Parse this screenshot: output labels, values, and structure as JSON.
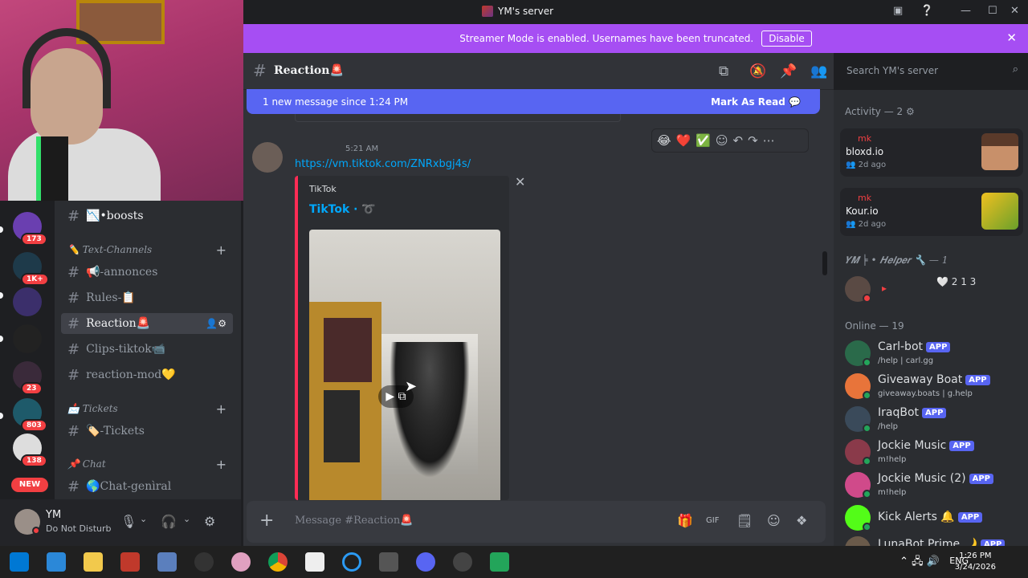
{
  "window": {
    "title": "YM's server"
  },
  "banner": {
    "text": "Streamer Mode is enabled. Usernames have been truncated.",
    "button": "Disable"
  },
  "servers": [
    {
      "badge": "173",
      "color": "#6a3fb0"
    },
    {
      "badge": "1K+",
      "color": "#1e3a4a"
    },
    {
      "badge": "",
      "color": "#3b2f6b"
    },
    {
      "badge": "",
      "color": "#222222"
    },
    {
      "badge": "23",
      "color": "#3a2a3a"
    },
    {
      "badge": "803",
      "color": "#1e5a6a"
    },
    {
      "badge": "138",
      "color": "#dddddd"
    }
  ],
  "new_badge": "NEW",
  "channels": {
    "top": "📉•boosts",
    "cat1": "✏️ Text-Channels",
    "c1": "📢-annonces",
    "c2": "Rules-📋",
    "c3": "Reaction🚨",
    "c4": "Clips-tiktok📹",
    "c5": "reaction-mod💛",
    "cat2": "📩 Tickets",
    "c6": "🏷️-Tickets",
    "cat3": "📌 Chat",
    "c7": "🌎Chat-genìral"
  },
  "user": {
    "name": "YM",
    "status": "Do Not Disturb"
  },
  "header": {
    "channel": "Reaction🚨",
    "search": "Search YM's server"
  },
  "new_messages": {
    "text": "1 new message since 1:24 PM",
    "action": "Mark As Read"
  },
  "message": {
    "time": "5:21 AM",
    "link": "https://vm.tiktok.com/ZNRxbgj4s/",
    "embed_provider": "TikTok",
    "embed_author": "TikTok · ➰"
  },
  "reactions": [
    "😂",
    "❤️",
    "✅"
  ],
  "composer": {
    "placeholder": "Message #Reaction🚨"
  },
  "members": {
    "activity_header": "Activity — 2",
    "activity": [
      {
        "user": "mk",
        "game": "bloxd.io",
        "time": "2d ago"
      },
      {
        "user": "mk",
        "game": "Kour.io",
        "time": "2d ago"
      }
    ],
    "helper_header": "𝒀𝑴 ╞ • 𝑯𝒆𝒍𝒑𝒆𝒓 🔧 — 1",
    "helper_badge": "🤍 2 1 3",
    "online_header": "Online — 19",
    "online": [
      {
        "name": "Carl-bot",
        "sub": "/help | carl.gg",
        "tag": "APP",
        "color": "#2a6a4a"
      },
      {
        "name": "Giveaway Boat",
        "sub": "giveaway.boats | g.help",
        "tag": "APP",
        "color": "#e8743a"
      },
      {
        "name": "IraqBot",
        "sub": "/help",
        "tag": "APP",
        "color": "#3a4a5a"
      },
      {
        "name": "Jockie Music",
        "sub": "m!help",
        "tag": "APP",
        "color": "#8a3a4a"
      },
      {
        "name": "Jockie Music (2)",
        "sub": "m!help",
        "tag": "APP",
        "color": "#d04a8a"
      },
      {
        "name": "Kick Alerts 🔔",
        "sub": "",
        "tag": "APP",
        "color": "#53fc18"
      },
      {
        "name": "LunaBot Prime 🌙",
        "sub": "",
        "tag": "APP",
        "color": "#6a5a4a"
      }
    ]
  },
  "taskbar": {
    "lang": "ENG",
    "time": "1:26 PM",
    "date": "3/24/2026"
  }
}
